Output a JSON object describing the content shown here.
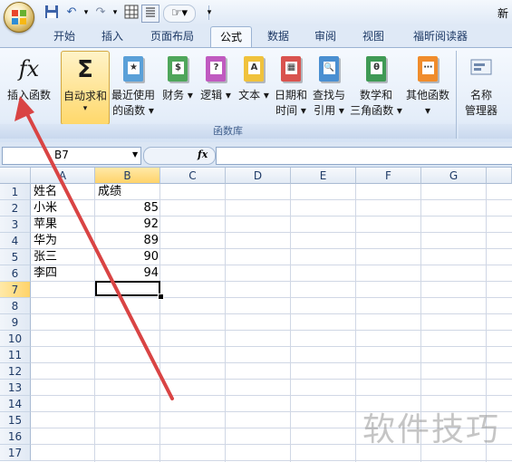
{
  "window": {
    "title": "新"
  },
  "quick_access": {
    "save_icon": "save-icon",
    "undo_icon": "undo-icon",
    "redo_icon": "redo-icon",
    "customize": "▾"
  },
  "tabs": [
    "开始",
    "插入",
    "页面布局",
    "公式",
    "数据",
    "审阅",
    "视图",
    "福昕阅读器"
  ],
  "active_tab": "公式",
  "ribbon": {
    "group_label": "函数库",
    "buttons": {
      "insert_function": "插入函数",
      "insert_function_icon_text": "fx",
      "autosum": "自动求和",
      "autosum_icon_text": "Σ",
      "recent_line1": "最近使用",
      "recent_line2": "的函数 ▾",
      "financial": "财务 ▾",
      "logical": "逻辑 ▾",
      "text": "文本 ▾",
      "datetime_line1": "日期和",
      "datetime_line2": "时间 ▾",
      "lookup_line1": "查找与",
      "lookup_line2": "引用 ▾",
      "math_line1": "数学和",
      "math_line2": "三角函数 ▾",
      "more": "其他函数 ▾",
      "name_manager_line1": "名称",
      "name_manager_line2": "管理器",
      "dropdown_caret": "▾"
    },
    "book_symbols": {
      "recent": "★",
      "financial": "$",
      "logical": "?",
      "text": "A",
      "datetime": "▦",
      "lookup": "🔍",
      "math": "θ",
      "more": "⋯"
    },
    "colors": {
      "recent": "#5aa0d8",
      "financial": "#4fa65b",
      "logical": "#c05ac0",
      "text": "#f0c23c",
      "datetime": "#d9534f",
      "lookup": "#4a8fd1",
      "math": "#3f9a55",
      "more": "#f08c2c"
    }
  },
  "formula_bar": {
    "name_box": "B7",
    "fx_label": "fx",
    "formula": ""
  },
  "columns": [
    "A",
    "B",
    "C",
    "D",
    "E",
    "F",
    "G"
  ],
  "rows": [
    "1",
    "2",
    "3",
    "4",
    "5",
    "6",
    "7",
    "8",
    "9",
    "10",
    "11",
    "12",
    "13",
    "14",
    "15",
    "16",
    "17"
  ],
  "selected": {
    "column": "B",
    "row": "7"
  },
  "table": [
    {
      "name": "姓名",
      "score": "成绩"
    },
    {
      "name": "小米",
      "score": "85"
    },
    {
      "name": "苹果",
      "score": "92"
    },
    {
      "name": "华为",
      "score": "89"
    },
    {
      "name": "张三",
      "score": "90"
    },
    {
      "name": "李四",
      "score": "94"
    }
  ],
  "watermark": "软件技巧",
  "annotation_color": "#d94444"
}
